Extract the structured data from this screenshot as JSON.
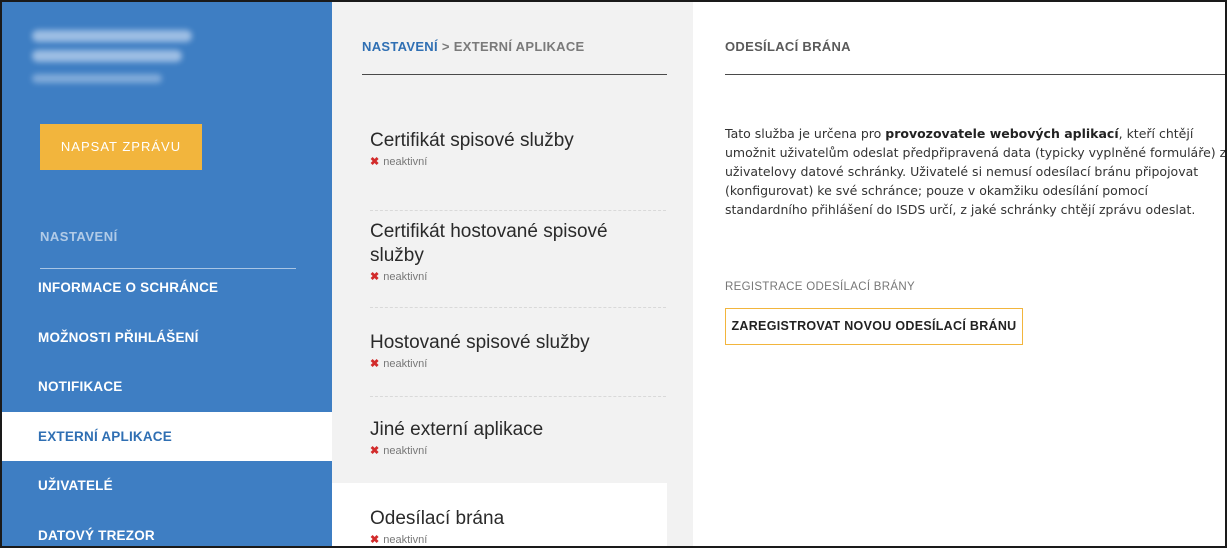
{
  "sidebar": {
    "compose_label": "NAPSAT ZPRÁVU",
    "section_label": "NASTAVENÍ",
    "items": [
      {
        "label": "INFORMACE O SCHRÁNCE"
      },
      {
        "label": "MOŽNOSTI PŘIHLÁŠENÍ"
      },
      {
        "label": "NOTIFIKACE"
      },
      {
        "label": "EXTERNÍ APLIKACE"
      },
      {
        "label": "UŽIVATELÉ"
      },
      {
        "label": "DATOVÝ TREZOR"
      }
    ],
    "active_item": "EXTERNÍ APLIKACE"
  },
  "breadcrumb": {
    "root": "NASTAVENÍ",
    "separator": ">",
    "current": "EXTERNÍ APLIKACE"
  },
  "apps": [
    {
      "title": "Certifikát spisové služby",
      "status": "neaktivní"
    },
    {
      "title": "Certifikát hostované spisové služby",
      "status": "neaktivní"
    },
    {
      "title": "Hostované spisové služby",
      "status": "neaktivní"
    },
    {
      "title": "Jiné externí aplikace",
      "status": "neaktivní"
    },
    {
      "title": "Odesílací brána",
      "status": "neaktivní"
    }
  ],
  "detail": {
    "title": "ODESÍLACÍ BRÁNA",
    "desc_part1": "Tato služba je určena pro ",
    "desc_bold": "provozovatele webových aplikací",
    "desc_part2": ", kteří chtějí umožnit uživatelům odeslat předpřipravená data (typicky vyplněné formuláře) z uživatelovy datové schránky. Uživatelé si nemusí odesílací bránu připojovat (konfigurovat) ke své schránce; pouze v okamžiku odesílání pomocí standardního přihlášení do ISDS určí, z jaké schránky chtějí zprávu odeslat.",
    "reg_label": "REGISTRACE ODESÍLACÍ BRÁNY",
    "reg_button": "ZAREGISTROVAT NOVOU ODESÍLACÍ BRÁNU"
  },
  "colors": {
    "sidebar_bg": "#3e7ec3",
    "accent_yellow": "#f2b53d",
    "link_blue": "#2f6fb3",
    "inactive_red": "#d22b2b"
  }
}
